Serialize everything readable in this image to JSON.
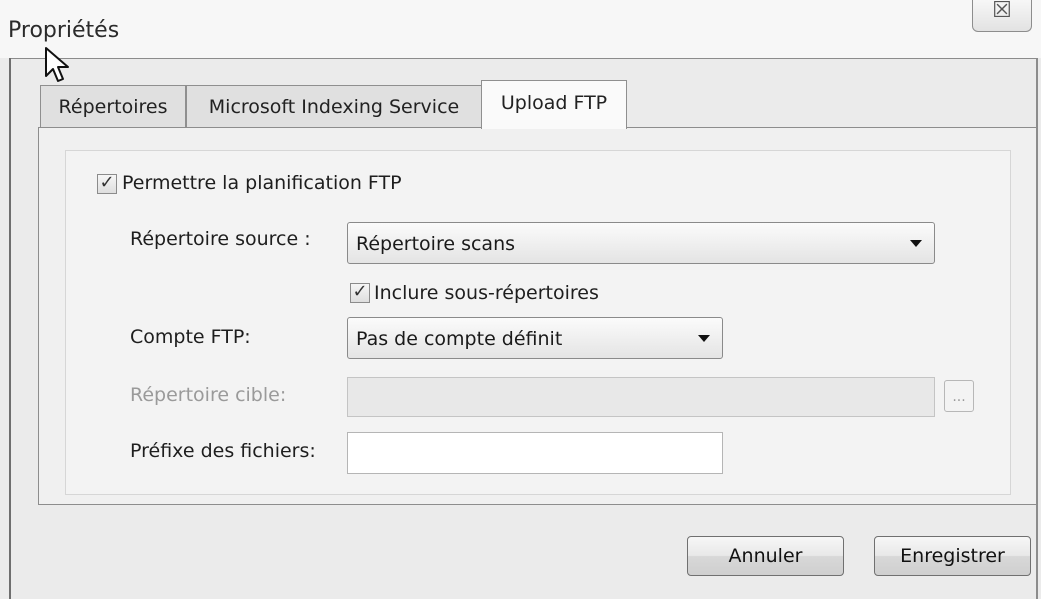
{
  "window": {
    "title": "Propriétés",
    "close_glyph": "☒"
  },
  "tabs": [
    {
      "label": "Répertoires",
      "active": false
    },
    {
      "label": "Microsoft Indexing Service",
      "active": false
    },
    {
      "label": "Upload FTP",
      "active": true
    }
  ],
  "ftp": {
    "enable_label": "Permettre la planification FTP",
    "enable_checked": true,
    "source_label": "Répertoire source :",
    "source_value": "Répertoire scans",
    "include_sub_label": "Inclure sous-répertoires",
    "include_sub_checked": true,
    "account_label": "Compte FTP:",
    "account_value": "Pas de compte définit",
    "target_label": "Répertoire cible:",
    "target_value": "",
    "browse_label": "...",
    "prefix_label": "Préfixe des fichiers:",
    "prefix_value": ""
  },
  "buttons": {
    "cancel": "Annuler",
    "save": "Enregistrer"
  },
  "icons": {
    "check": "✓",
    "dropdown_arrow": "chevron-down-icon",
    "cursor": "mouse-pointer-icon"
  }
}
